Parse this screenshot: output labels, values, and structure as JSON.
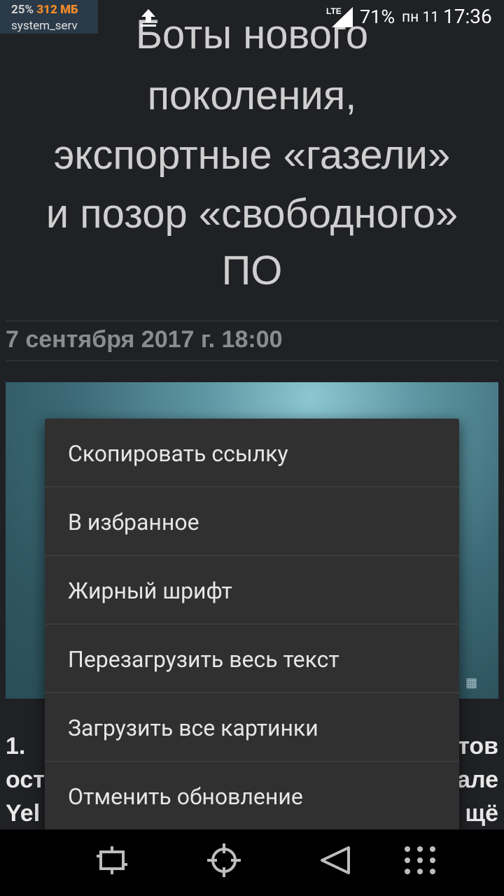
{
  "status_bar": {
    "cpu": "25%",
    "memory": "312 МБ",
    "process": "system_serv",
    "network": "LTE",
    "battery": "71%",
    "day": "пн 11",
    "time": "17:36"
  },
  "article": {
    "title_lines": [
      "Боты нового",
      "поколения,",
      "экспортные «газели»",
      "и позор «свободного»",
      "ПО"
    ],
    "date": "7 сентября 2017 г. 18:00",
    "body_left": [
      "1.",
      "ост",
      "Yel"
    ],
    "body_right": [
      "тов",
      "але",
      "щё"
    ]
  },
  "context_menu": {
    "items": [
      "Скопировать ссылку",
      "В избранное",
      "Жирный шрифт",
      "Перезагрузить весь текст",
      "Загрузить все картинки",
      "Отменить обновление"
    ]
  },
  "nav_bar": {
    "icons": [
      "crop-icon",
      "target-icon",
      "back-icon",
      "menu-dots-icon"
    ]
  },
  "colors": {
    "background": "#1f2124",
    "menu_background": "#303030",
    "memory_accent": "#f08a2a"
  }
}
